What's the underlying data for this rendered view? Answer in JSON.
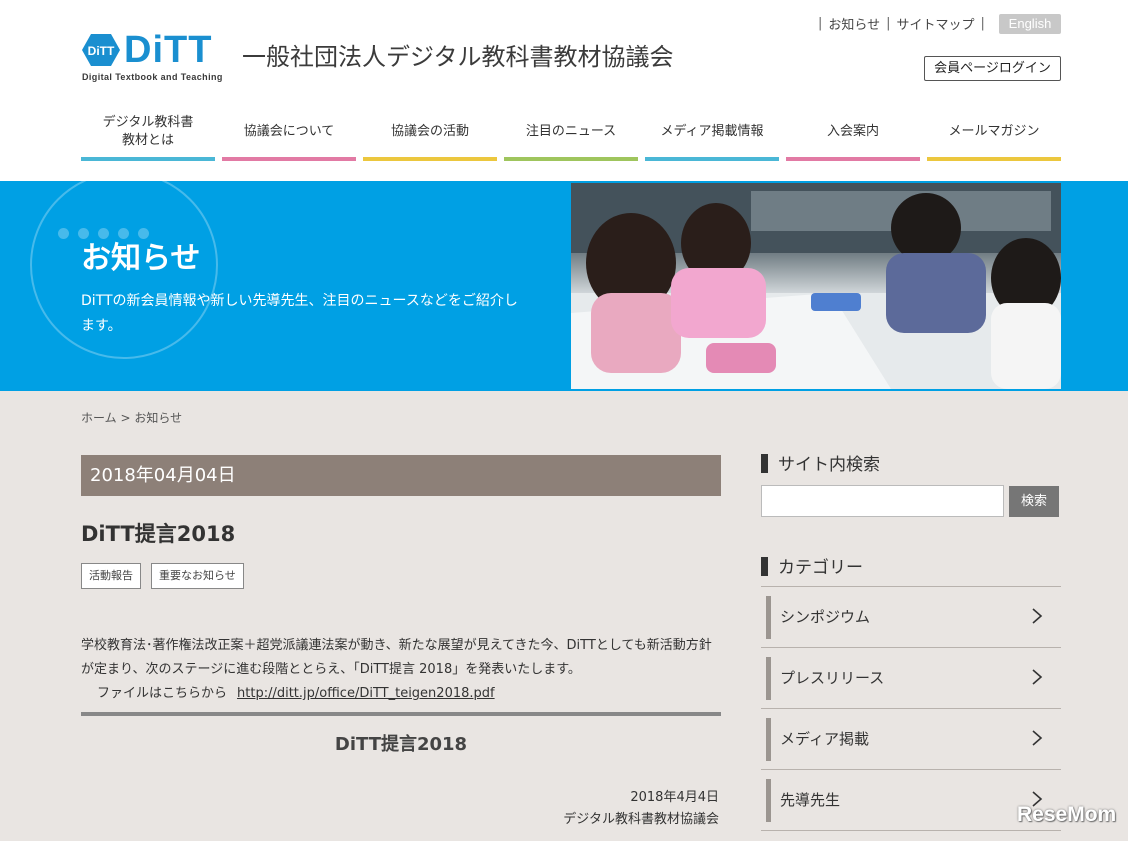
{
  "header": {
    "logo_text": "DiTT",
    "logo_subtext": "Digital Textbook and Teaching",
    "org_name": "一般社団法人デジタル教科書教材協議会",
    "util_links": [
      "お知らせ",
      "サイトマップ"
    ],
    "lang_button": "English",
    "login_button": "会員ページログイン"
  },
  "nav": [
    {
      "label": "デジタル教科書\n教材とは",
      "color": "#4ab7d6"
    },
    {
      "label": "協議会について",
      "color": "#e27aa4"
    },
    {
      "label": "協議会の活動",
      "color": "#ecc73e"
    },
    {
      "label": "注目のニュース",
      "color": "#9fc55d"
    },
    {
      "label": "メディア掲載情報",
      "color": "#4ab7d6"
    },
    {
      "label": "入会案内",
      "color": "#e27aa4"
    },
    {
      "label": "メールマガジン",
      "color": "#ecc73e"
    }
  ],
  "hero": {
    "title": "お知らせ",
    "description": "DiTTの新会員情報や新しい先導先生、注目のニュースなどをご紹介します。",
    "bg_color": "#00a0e4"
  },
  "breadcrumb": {
    "home": "ホーム",
    "sep": ">",
    "current": "お知らせ"
  },
  "post": {
    "date": "2018年04月04日",
    "title": "DiTT提言2018",
    "tags": [
      "活動報告",
      "重要なお知らせ"
    ],
    "body": "学校教育法･著作権法改正案＋超党派議連法案が動き、新たな展望が見えてきた今、DiTTとしても新活動方針が定まり、次のステージに進む段階ととらえ、「DiTT提言 2018」を発表いたします。",
    "file_label": "ファイルはこちらから",
    "file_link": "http://ditt.jp/office/DiTT_teigen2018.pdf",
    "doc_title": "DiTT提言2018",
    "doc_date": "2018年4月4日",
    "doc_org": "デジタル教科書教材協議会"
  },
  "sidebar": {
    "search_heading": "サイト内検索",
    "search_placeholder": "",
    "search_button": "検索",
    "category_heading": "カテゴリー",
    "categories": [
      "シンポジウム",
      "プレスリリース",
      "メディア掲載",
      "先導先生"
    ]
  },
  "watermark": "ReseMom"
}
